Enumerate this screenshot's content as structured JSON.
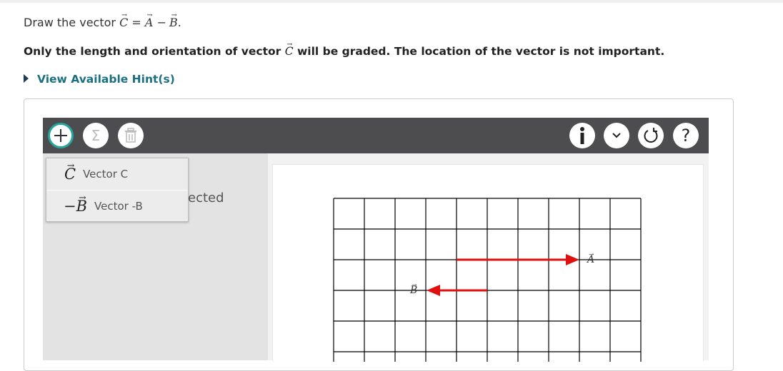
{
  "question": {
    "prompt_prefix": "Draw the vector",
    "c": "C",
    "eq": "=",
    "a": "A",
    "minus": "−",
    "b": "B",
    "period": ".",
    "note_prefix": "Only the length and orientation of vector",
    "note_c": "C",
    "note_suffix": "will be graded. The location of the vector is not important."
  },
  "hint": {
    "label": "View Available Hint(s)"
  },
  "toolbar": {
    "left_icons": [
      "plus-icon",
      "sigma-icon",
      "trash-icon"
    ],
    "right_icons": [
      "info-icon",
      "chevron-down-icon",
      "reset-icon",
      "help-icon"
    ],
    "help_label": "?",
    "sigma_label": "Σ"
  },
  "dropdown": {
    "items": [
      {
        "symbol": "C",
        "label": "Vector C"
      },
      {
        "symbol": "B",
        "minus": "−",
        "label": "Vector -B"
      }
    ]
  },
  "left_pane": {
    "partial_text": "ected"
  },
  "canvas": {
    "vectors": [
      {
        "name": "A",
        "color": "#e01010",
        "direction": "right",
        "length_units": 4
      },
      {
        "name": "B",
        "color": "#e01010",
        "direction": "left",
        "length_units": 2
      }
    ],
    "accent_color": "#26a69a"
  }
}
